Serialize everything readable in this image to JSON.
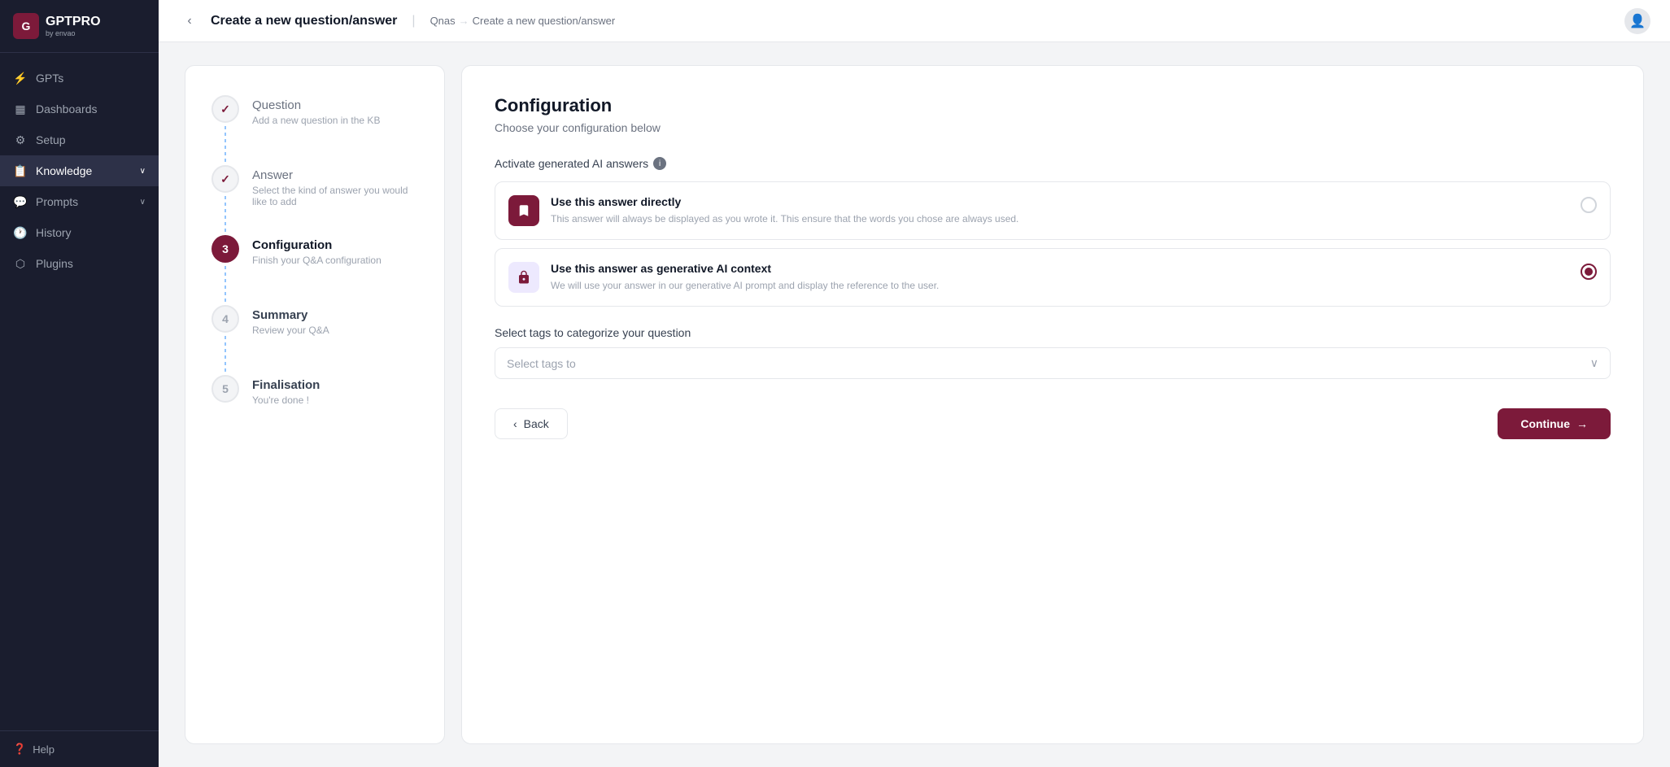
{
  "app": {
    "logo_text": "GPTPRO",
    "logo_sub": "by envao"
  },
  "sidebar": {
    "items": [
      {
        "id": "gpts",
        "label": "GPTs",
        "icon": "⚡"
      },
      {
        "id": "dashboards",
        "label": "Dashboards",
        "icon": "📊"
      },
      {
        "id": "setup",
        "label": "Setup",
        "icon": "⚙️"
      },
      {
        "id": "knowledge",
        "label": "Knowledge",
        "icon": "📚",
        "active": true,
        "has_chevron": true
      },
      {
        "id": "prompts",
        "label": "Prompts",
        "icon": "💬",
        "has_chevron": true
      },
      {
        "id": "history",
        "label": "History",
        "icon": "🕐"
      },
      {
        "id": "plugins",
        "label": "Plugins",
        "icon": "🔌"
      }
    ],
    "footer": {
      "icon": "❓",
      "label": "Help"
    }
  },
  "header": {
    "title": "Create a new question/answer",
    "breadcrumb_root": "Qnas",
    "breadcrumb_sep": "→",
    "breadcrumb_current": "Create a new question/answer"
  },
  "steps": [
    {
      "number": "1",
      "state": "completed",
      "title": "Question",
      "desc": "Add a new question in the KB"
    },
    {
      "number": "2",
      "state": "completed",
      "title": "Answer",
      "desc": "Select the kind of answer you would like to add"
    },
    {
      "number": "3",
      "state": "active",
      "title": "Configuration",
      "desc": "Finish your Q&A configuration"
    },
    {
      "number": "4",
      "state": "pending",
      "title": "Summary",
      "desc": "Review your Q&A"
    },
    {
      "number": "5",
      "state": "pending",
      "title": "Finalisation",
      "desc": "You're done !"
    }
  ],
  "config": {
    "title": "Configuration",
    "subtitle": "Choose your configuration below",
    "ai_answers_label": "Activate generated AI answers",
    "options": [
      {
        "id": "direct",
        "icon": "🔖",
        "icon_style": "bookmark",
        "title": "Use this answer directly",
        "desc": "This answer will always be displayed as you wrote it. This ensure that the words you chose are always used.",
        "selected": false
      },
      {
        "id": "ai",
        "icon": "🔒",
        "icon_style": "ai",
        "title": "Use this answer as generative AI context",
        "desc": "We will use your answer in our generative AI prompt and display the reference to the user.",
        "selected": true
      }
    ],
    "tags_label": "Select tags to categorize your question",
    "tags_placeholder": "Select tags to",
    "btn_back": "Back",
    "btn_continue": "Continue"
  }
}
